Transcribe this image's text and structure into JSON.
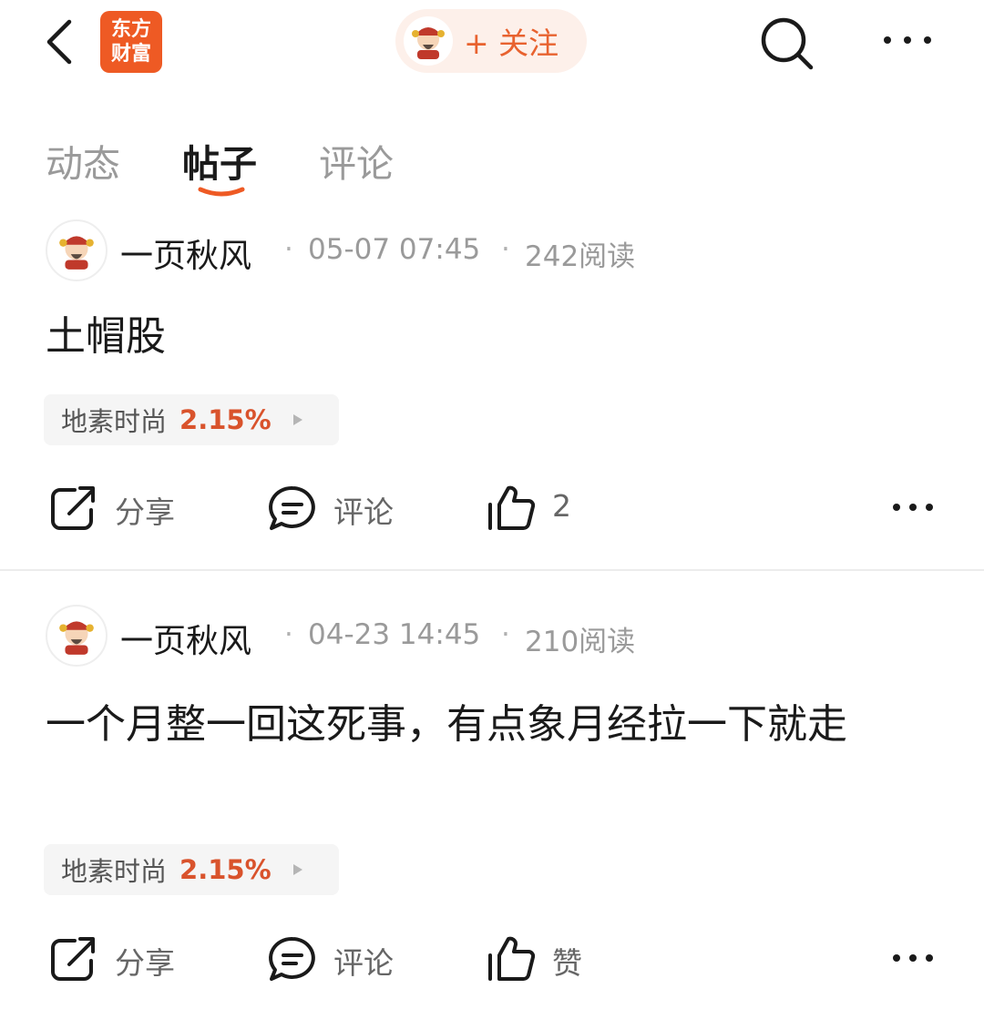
{
  "header": {
    "logo_line1": "东方",
    "logo_line2": "财富",
    "follow_label": "+ 关注",
    "icons": {
      "back": "back-arrow-icon",
      "search": "search-icon",
      "more": "more-dots-icon"
    },
    "brand_color": "#ee5a24"
  },
  "tabs": [
    {
      "label": "动态",
      "active": false
    },
    {
      "label": "帖子",
      "active": true
    },
    {
      "label": "评论",
      "active": false
    }
  ],
  "posts": [
    {
      "author": "一页秋风",
      "date": "05-07 07:45",
      "reads": "242阅读",
      "title": "土帽股",
      "stock_name": "地素时尚",
      "stock_change": "2.15%",
      "share_label": "分享",
      "comment_label": "评论",
      "like_label": "2"
    },
    {
      "author": "一页秋风",
      "date": "04-23 14:45",
      "reads": "210阅读",
      "title": "一个月整一回这死事，有点象月经拉一下就走",
      "stock_name": "地素时尚",
      "stock_change": "2.15%",
      "share_label": "分享",
      "comment_label": "评论",
      "like_label": "赞"
    }
  ],
  "colors": {
    "accent": "#e8622f",
    "stock_up": "#d9532c",
    "muted": "#9a9a9a"
  }
}
